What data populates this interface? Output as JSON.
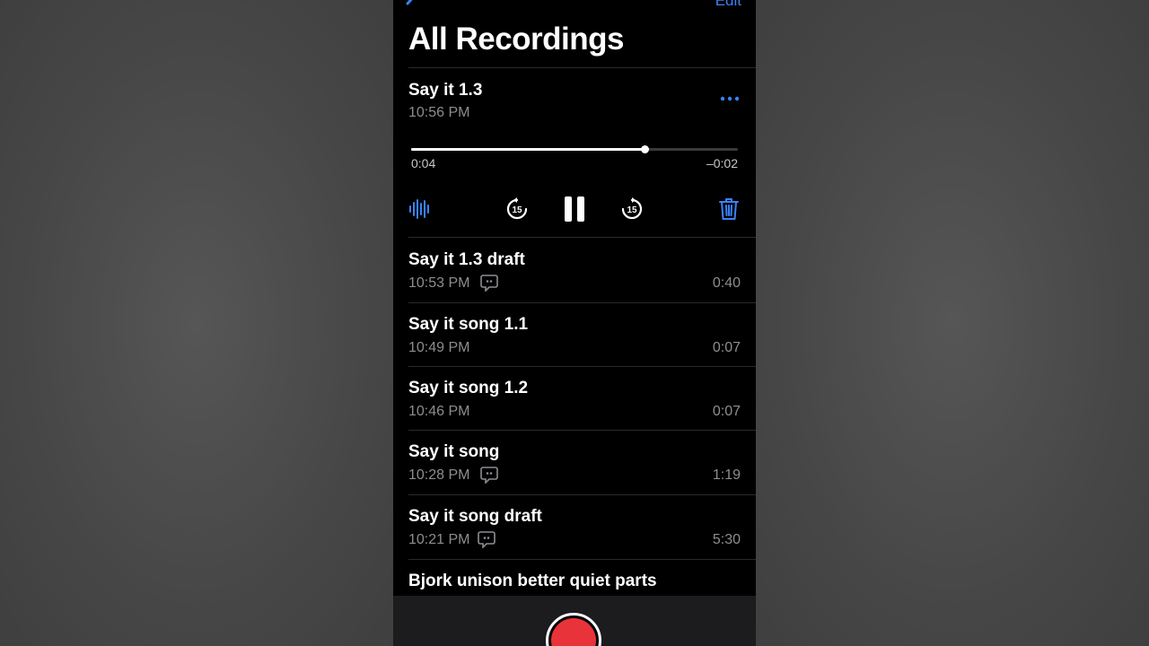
{
  "nav": {
    "back_icon": "chevron-left-icon",
    "edit_label": "Edit",
    "title": "All Recordings"
  },
  "active": {
    "title": "Say it 1.3",
    "time": "10:56 PM",
    "elapsed": "0:04",
    "remaining": "–0:02",
    "progress": 0.715,
    "icons": {
      "more": "ellipsis-icon",
      "waveform": "waveform-icon",
      "skip_back": "skip-back-15-icon",
      "pause": "pause-icon",
      "skip_forward": "skip-forward-15-icon",
      "trash": "trash-icon"
    },
    "skip_label": "15"
  },
  "recordings": [
    {
      "title": "Say it 1.3 draft",
      "time": "10:53 PM",
      "duration": "0:40",
      "transcript": true
    },
    {
      "title": "Say it song 1.1",
      "time": "10:49 PM",
      "duration": "0:07",
      "transcript": false
    },
    {
      "title": "Say it song 1.2",
      "time": "10:46 PM",
      "duration": "0:07",
      "transcript": false
    },
    {
      "title": "Say it song",
      "time": "10:28 PM",
      "duration": "1:19",
      "transcript": true
    },
    {
      "title": "Say it song draft",
      "time": "10:21 PM",
      "duration": "5:30",
      "transcript": true
    },
    {
      "title": "Bjork unison better quiet parts",
      "time": "",
      "duration": "",
      "transcript": true
    }
  ],
  "colors": {
    "accent": "#3a82f7",
    "record": "#e8333a",
    "secondary_text": "#8d8d92",
    "background": "#000000"
  },
  "bottom": {
    "record_icon": "record-icon"
  }
}
